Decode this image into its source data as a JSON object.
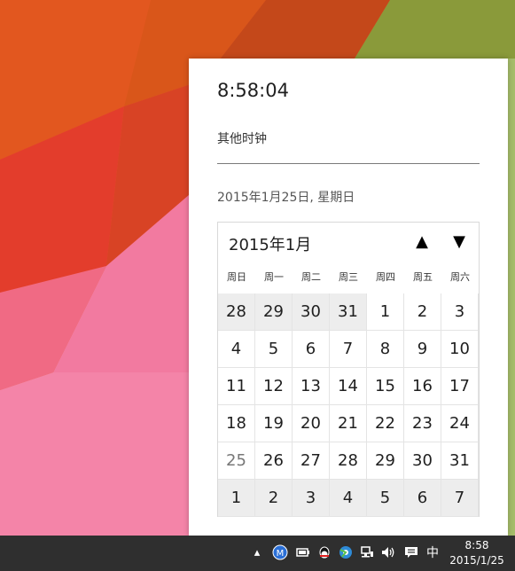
{
  "flyout": {
    "time": "8:58:04",
    "other_clocks_link": "其他时钟",
    "full_date": "2015年1月25日, 星期日"
  },
  "calendar": {
    "month_label": "2015年1月",
    "prev_icon": "▲",
    "next_icon": "▼",
    "weekdays": [
      "周日",
      "周一",
      "周二",
      "周三",
      "周四",
      "周五",
      "周六"
    ],
    "weeks": [
      [
        "28",
        "29",
        "30",
        "31",
        "1",
        "2",
        "3"
      ],
      [
        "4",
        "5",
        "6",
        "7",
        "8",
        "9",
        "10"
      ],
      [
        "11",
        "12",
        "13",
        "14",
        "15",
        "16",
        "17"
      ],
      [
        "18",
        "19",
        "20",
        "21",
        "22",
        "23",
        "24"
      ],
      [
        "25",
        "26",
        "27",
        "28",
        "29",
        "30",
        "31"
      ],
      [
        "1",
        "2",
        "3",
        "4",
        "5",
        "6",
        "7"
      ]
    ]
  },
  "taskbar": {
    "tray_icons": [
      "show-hidden-icons",
      "m-app-icon",
      "battery-icon",
      "qq-icon",
      "browser-icon",
      "network-icon",
      "volume-icon",
      "action-center-icon"
    ],
    "input_method": "中",
    "clock_time": "8:58",
    "clock_date": "2015/1/25"
  }
}
